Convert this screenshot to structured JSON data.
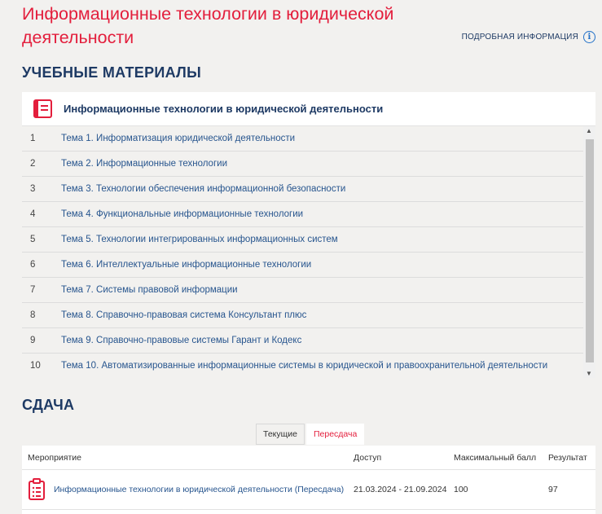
{
  "page": {
    "title": "Информационные технологии в юридической деятельности",
    "more_info": "ПОДРОБНАЯ ИНФОРМАЦИЯ"
  },
  "materials": {
    "heading": "УЧЕБНЫЕ МАТЕРИАЛЫ",
    "course_title": "Информационные технологии в юридической деятельности",
    "topics": [
      {
        "num": "1",
        "name": "Тема 1. Информатизация юридической деятельности"
      },
      {
        "num": "2",
        "name": "Тема 2. Информационные технологии"
      },
      {
        "num": "3",
        "name": "Тема 3. Технологии обеспечения информационной безопасности"
      },
      {
        "num": "4",
        "name": "Тема 4. Функциональные информационные технологии"
      },
      {
        "num": "5",
        "name": "Тема 5. Технологии интегрированных информационных систем"
      },
      {
        "num": "6",
        "name": "Тема 6. Интеллектуальные информационные технологии"
      },
      {
        "num": "7",
        "name": "Тема 7. Системы правовой информации"
      },
      {
        "num": "8",
        "name": "Тема 8. Справочно-правовая система Консультант плюс"
      },
      {
        "num": "9",
        "name": "Тема 9. Справочно-правовые системы Гарант и Кодекс"
      },
      {
        "num": "10",
        "name": "Тема 10. Автоматизированные информационные системы в юридической и правоохранительной деятельности"
      }
    ]
  },
  "submission": {
    "heading": "СДАЧА",
    "tabs": [
      "Текущие",
      "Пересдача"
    ],
    "active_tab": "Пересдача",
    "columns": [
      "Мероприятие",
      "Доступ",
      "Максимальный балл",
      "Результат"
    ],
    "rows": [
      {
        "event": "Информационные технологии в юридической деятельности (Пересдача)",
        "access": "21.03.2024 - 21.09.2024",
        "max_score": "100",
        "result": "97"
      }
    ]
  },
  "colors": {
    "accent": "#e31e3c",
    "heading": "#1e3a64",
    "link": "#27558e"
  }
}
